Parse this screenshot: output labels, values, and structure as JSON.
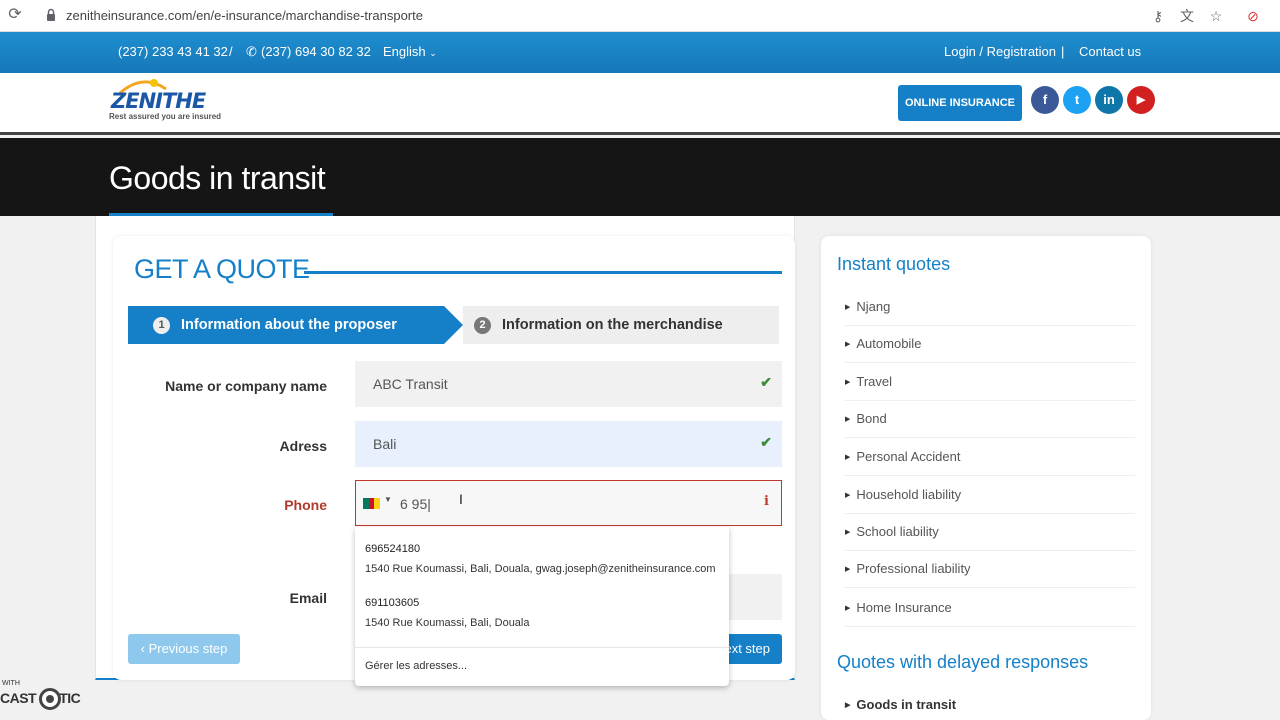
{
  "browser": {
    "url": "zenitheinsurance.com/en/e-insurance/marchandise-transporte"
  },
  "topbar": {
    "phone1": "(237) 233 43 41 32",
    "separator": "/",
    "phone2": "(237) 694 30 82 32",
    "language": "English",
    "login": "Login / Registration",
    "pipe": "|",
    "contact": "Contact us"
  },
  "header": {
    "logo_word": "ZENITHE",
    "tagline": "Rest assured you are insured",
    "online_insurance": "ONLINE INSURANCE",
    "social": {
      "facebook": "f",
      "twitter": "t",
      "linkedin": "in",
      "youtube": "▶"
    }
  },
  "banner": {
    "title": "Goods in transit"
  },
  "quote": {
    "title": "GET A QUOTE",
    "steps": [
      {
        "num": "1",
        "label": "Information about the proposer"
      },
      {
        "num": "2",
        "label": "Information on the merchandise"
      }
    ],
    "fields": {
      "name_label": "Name or company name",
      "name_value": "ABC Transit",
      "address_label": "Adress",
      "address_value": "Bali",
      "phone_label": "Phone",
      "phone_value": "6 95",
      "email_label": "Email"
    },
    "prev_button": "‹ Previous step",
    "next_button": "Next step"
  },
  "autocomplete": {
    "suggestions": [
      {
        "number": "696524180",
        "address": "1540 Rue Koumassi, Bali, Douala, gwag.joseph@zenitheinsurance.com"
      },
      {
        "number": "691103605",
        "address": "1540 Rue Koumassi, Bali, Douala"
      }
    ],
    "manage": "Gérer les adresses..."
  },
  "sidebar": {
    "instant_title": "Instant quotes",
    "instant_items": [
      "Njang",
      "Automobile",
      "Travel",
      "Bond",
      "Personal Accident",
      "Household liability",
      "School liability",
      "Professional liability",
      "Home Insurance"
    ],
    "delayed_title": "Quotes with delayed responses",
    "delayed_items": [
      "Goods in transit"
    ]
  },
  "watermark": {
    "with": "WITH",
    "brand": "CAST   MATIC"
  },
  "colors": {
    "brand_blue": "#1580c8",
    "error_red": "#c0392b",
    "check_green": "#3c8d3c"
  }
}
